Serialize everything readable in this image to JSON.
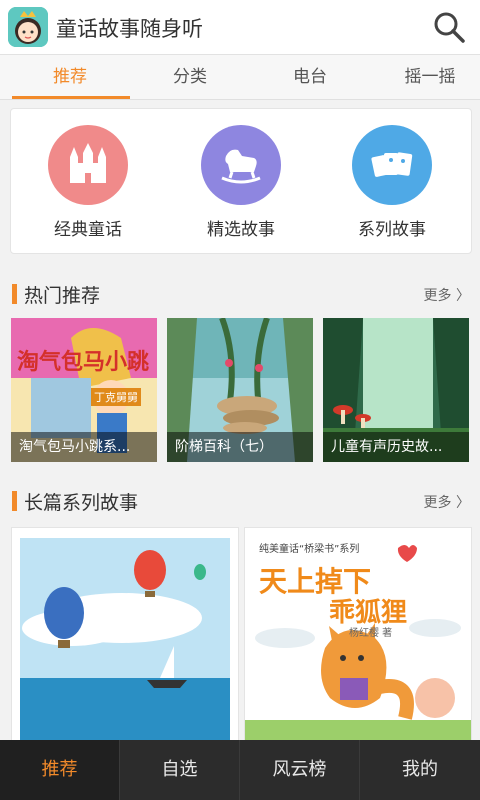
{
  "header": {
    "title": "童话故事随身听",
    "avatar_icon": "princess-avatar-icon",
    "search_icon": "search-icon"
  },
  "tabs": [
    {
      "label": "推荐",
      "active": true
    },
    {
      "label": "分类",
      "active": false
    },
    {
      "label": "电台",
      "active": false
    },
    {
      "label": "摇一摇",
      "active": false
    }
  ],
  "categories": [
    {
      "label": "经典童话",
      "icon": "castle-icon",
      "color": "#f08a8a"
    },
    {
      "label": "精选故事",
      "icon": "rocking-horse-icon",
      "color": "#8e86e0"
    },
    {
      "label": "系列故事",
      "icon": "cards-icon",
      "color": "#4fa9e6"
    }
  ],
  "hot": {
    "title": "热门推荐",
    "more": "更多",
    "items": [
      {
        "caption": "淘气包马小跳系...",
        "cover_title": "淘气包马小跳",
        "cover_sub": "丁克舅舅"
      },
      {
        "caption": "阶梯百科（七）"
      },
      {
        "caption": "儿童有声历史故..."
      }
    ]
  },
  "series": {
    "title": "长篇系列故事",
    "more": "更多",
    "items": [
      {
        "kind": "balloons"
      },
      {
        "series_label": "纯美童话“桥梁书”系列",
        "book_title_1": "天上掉下",
        "book_title_2": "乖狐狸",
        "author": "杨红樱 著"
      }
    ]
  },
  "bottom_nav": [
    {
      "label": "推荐",
      "active": true
    },
    {
      "label": "自选",
      "active": false
    },
    {
      "label": "风云榜",
      "active": false
    },
    {
      "label": "我的",
      "active": false
    }
  ],
  "colors": {
    "accent": "#f28a2a",
    "nav_bg": "#2c2c2c"
  }
}
